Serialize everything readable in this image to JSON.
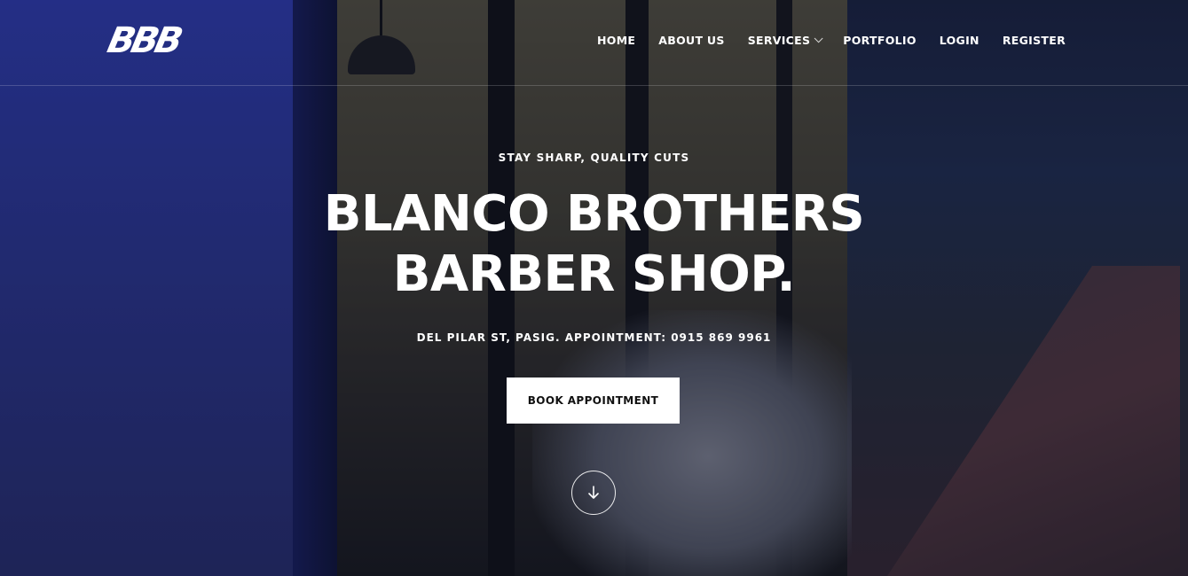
{
  "brand": {
    "logo_text": "BBB"
  },
  "nav": {
    "items": [
      {
        "label": "HOME"
      },
      {
        "label": "ABOUT US"
      },
      {
        "label": "SERVICES"
      },
      {
        "label": "PORTFOLIO"
      },
      {
        "label": "LOGIN"
      },
      {
        "label": "REGISTER"
      }
    ]
  },
  "hero": {
    "eyebrow": "STAY SHARP, QUALITY CUTS",
    "headline_line1": "BLANCO BROTHERS",
    "headline_line2": "BARBER SHOP.",
    "address": "DEL PILAR ST, PASIG. APPOINTMENT: 0915 869 9961",
    "cta_label": "BOOK APPOINTMENT",
    "scroll_icon": "arrow-down-icon"
  },
  "colors": {
    "text": "#ffffff",
    "cta_bg": "#ffffff",
    "cta_text": "#111111",
    "accent_blue": "#2f3ab0"
  }
}
